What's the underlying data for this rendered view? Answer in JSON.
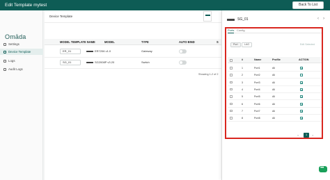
{
  "header": {
    "title": "Edit Template mytest",
    "back_label": "Back To List"
  },
  "sidebar": {
    "logo": "Omāda",
    "items": [
      {
        "label": "Settings",
        "active": false,
        "icon": "settings-icon"
      },
      {
        "label": "Device Template",
        "active": true,
        "icon": "template-icon"
      },
      {
        "label": "Logs",
        "active": false,
        "icon": "logs-icon"
      },
      {
        "label": "Audit Logs",
        "active": false,
        "icon": "audit-logs-icon"
      }
    ]
  },
  "main": {
    "card_title": "Device Template",
    "columns": [
      "MODEL TEMPLATE NAME",
      "MODEL",
      "TYPE",
      "AUTO BIND",
      "S"
    ],
    "rows": [
      {
        "name": "ER_01",
        "model": "ER7206 v1.0",
        "type": "Gateway",
        "auto_bind": false
      },
      {
        "name": "SG_01",
        "model": "SG2008P v3.20",
        "type": "Switch",
        "auto_bind": false
      }
    ],
    "showing": "Showing 1-2 of 2"
  },
  "drawer": {
    "title": "SG_01",
    "tabs": [
      {
        "label": "Ports",
        "active": true
      },
      {
        "label": "Config",
        "active": false
      }
    ],
    "filters": [
      {
        "label": "Port",
        "active": true
      },
      {
        "label": "LAG",
        "active": false
      }
    ],
    "edit_selected": "Edit Selected",
    "columns": [
      "#",
      "Name",
      "Profile",
      "ACTION"
    ],
    "ports": [
      {
        "num": "1",
        "name": "Port1",
        "profile": "All"
      },
      {
        "num": "2",
        "name": "Port2",
        "profile": "All"
      },
      {
        "num": "3",
        "name": "Port3",
        "profile": "All"
      },
      {
        "num": "4",
        "name": "Port4",
        "profile": "All"
      },
      {
        "num": "5",
        "name": "Port5",
        "profile": "All"
      },
      {
        "num": "6",
        "name": "Port6",
        "profile": "All"
      },
      {
        "num": "7",
        "name": "Port7",
        "profile": "All"
      },
      {
        "num": "8",
        "name": "Port8",
        "profile": "All"
      }
    ],
    "pagination": {
      "prev": "<",
      "current": "1",
      "next": ">"
    }
  },
  "colors": {
    "brand": "#0e5c55",
    "highlight": "#d9261f",
    "chat": "#19a05a"
  }
}
